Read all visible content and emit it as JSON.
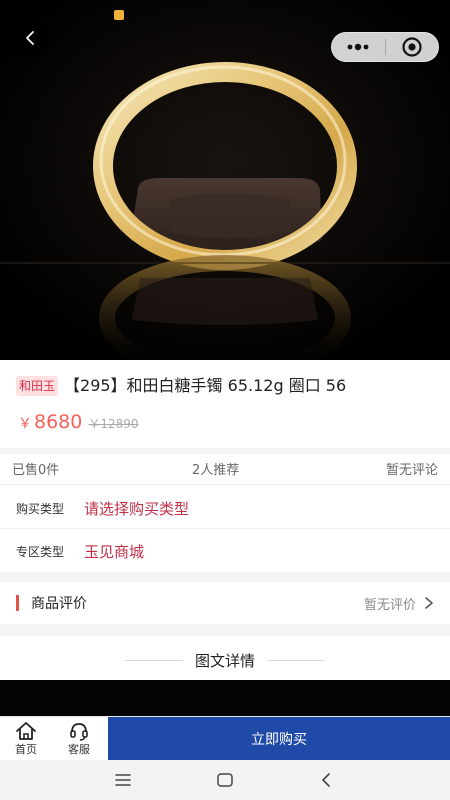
{
  "status_bar": {
    "left_text": "",
    "right_text": ""
  },
  "icons": {
    "back": "chevron-left-icon",
    "more": "more-dots-icon",
    "close": "target-circle-icon",
    "home": "home-icon",
    "service": "headset-icon",
    "review_arrow": "chevron-right-icon",
    "nav_menu": "menu-icon",
    "nav_home": "square-icon",
    "nav_back": "triangle-back-icon"
  },
  "product": {
    "tag": "和田玉",
    "title": "【295】和田白糖手镯 65.12g 圈口 56",
    "price_symbol": "￥",
    "price": "8680",
    "original_price": "￥12890"
  },
  "stats": {
    "sold": "已售0件",
    "recommend": "2人推荐",
    "comments": "暂无评论"
  },
  "specs": [
    {
      "label": "购买类型",
      "value": "请选择购买类型"
    },
    {
      "label": "专区类型",
      "value": "玉见商城"
    }
  ],
  "review": {
    "title": "商品评价",
    "empty": "暂无评价"
  },
  "detail": {
    "title": "图文详情"
  },
  "bottom": {
    "home_label": "首页",
    "service_label": "客服",
    "buy_label": "立即购买"
  },
  "colors": {
    "accent_price": "#f4625a",
    "spec_value": "#c12f48",
    "buy_button": "#1f4aa8",
    "tag_bg": "#fde0e2"
  }
}
